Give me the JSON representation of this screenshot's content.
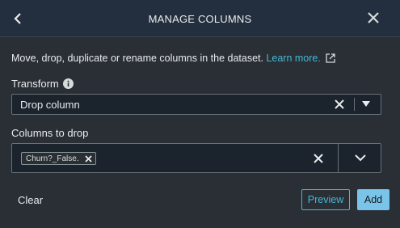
{
  "header": {
    "title": "MANAGE COLUMNS",
    "back_icon": "chevron-left-icon",
    "close_icon": "close-icon"
  },
  "description": {
    "text": "Move, drop, duplicate or rename columns in the dataset. ",
    "link": "Learn more.",
    "link_icon": "external-link-icon"
  },
  "transform": {
    "label": "Transform",
    "info_icon": "info-icon",
    "selected": "Drop column"
  },
  "columns": {
    "label": "Columns to drop",
    "tokens": [
      "Churn?_False."
    ]
  },
  "footer": {
    "clear_label": "Clear",
    "preview_label": "Preview",
    "add_label": "Add"
  },
  "colors": {
    "background": "#2a2e35",
    "header": "#232f3e",
    "link": "#44b9d6",
    "primary_button": "#7ac4ea"
  }
}
